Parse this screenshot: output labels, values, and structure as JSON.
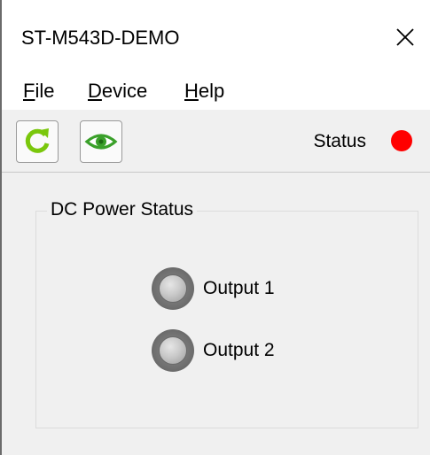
{
  "window": {
    "title": "ST-M543D-DEMO"
  },
  "menu": {
    "items": [
      {
        "mnemonic": "F",
        "rest": "ile"
      },
      {
        "mnemonic": "D",
        "rest": "evice"
      },
      {
        "mnemonic": "H",
        "rest": "elp"
      }
    ]
  },
  "toolbar": {
    "buttons": [
      {
        "icon": "refresh-icon",
        "color": "#7ac70c"
      },
      {
        "icon": "eye-icon",
        "color": "#3aa02a"
      }
    ],
    "status_label": "Status",
    "status_color": "#ff0000"
  },
  "power_group": {
    "title": "DC Power Status",
    "outputs": [
      {
        "label": "Output 1",
        "state": "off"
      },
      {
        "label": "Output 2",
        "state": "off"
      }
    ]
  }
}
